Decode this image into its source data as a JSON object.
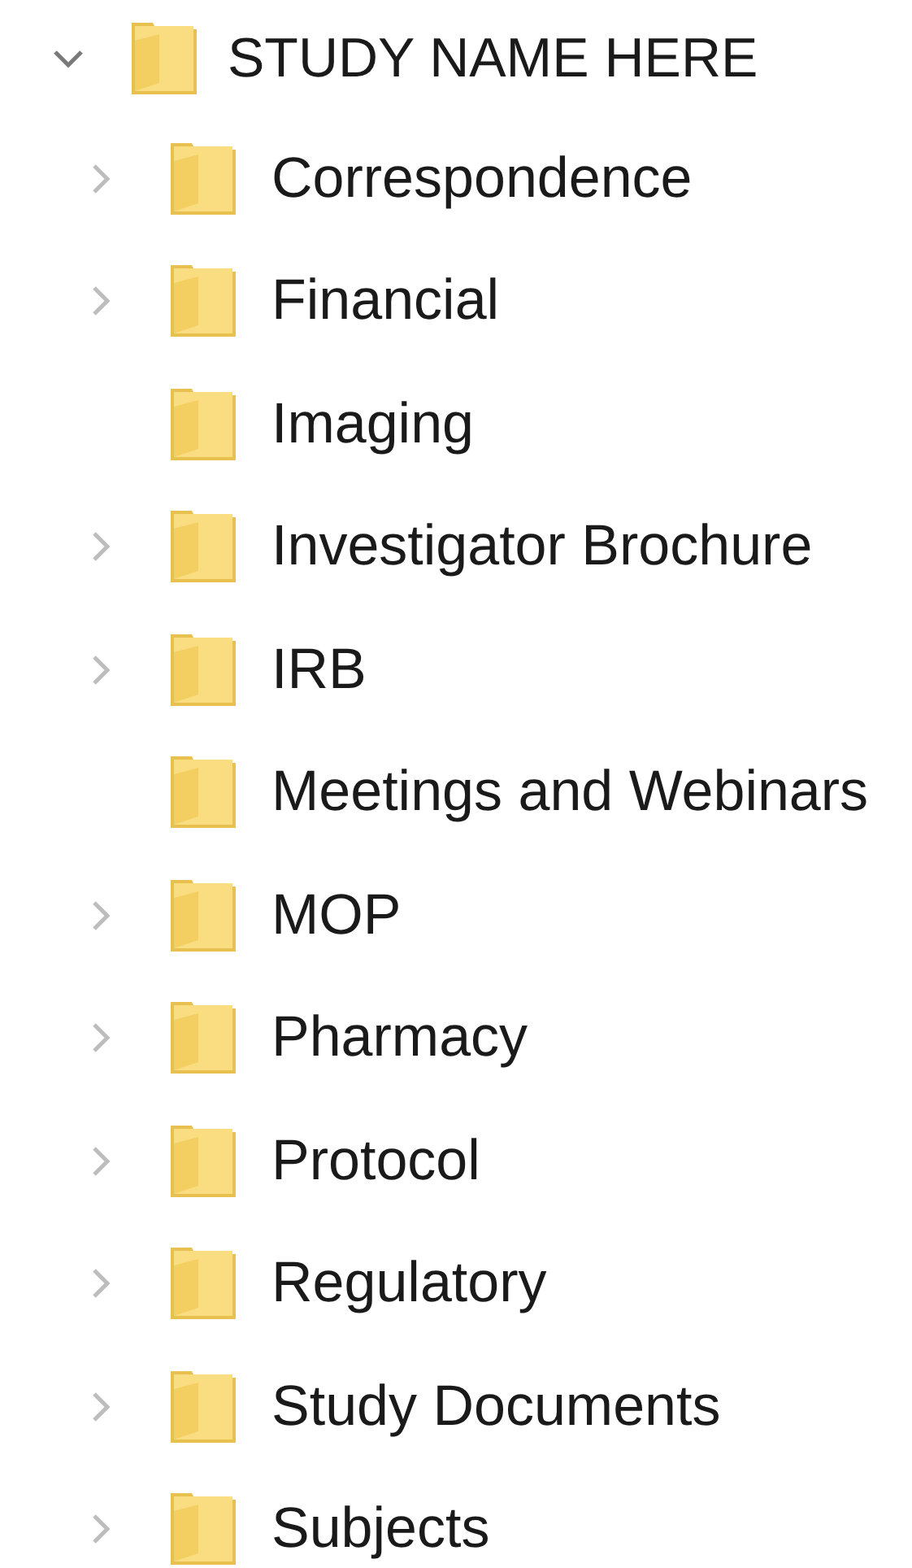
{
  "tree": {
    "label": "STUDY NAME HERE",
    "expanded": true,
    "children": [
      {
        "label": "Correspondence",
        "expandable": true
      },
      {
        "label": "Financial",
        "expandable": true
      },
      {
        "label": "Imaging",
        "expandable": false
      },
      {
        "label": "Investigator Brochure",
        "expandable": true
      },
      {
        "label": "IRB",
        "expandable": true
      },
      {
        "label": "Meetings and Webinars",
        "expandable": false
      },
      {
        "label": "MOP",
        "expandable": true
      },
      {
        "label": "Pharmacy",
        "expandable": true
      },
      {
        "label": "Protocol",
        "expandable": true
      },
      {
        "label": "Regulatory",
        "expandable": true
      },
      {
        "label": "Study Documents",
        "expandable": true
      },
      {
        "label": "Subjects",
        "expandable": true
      }
    ]
  }
}
